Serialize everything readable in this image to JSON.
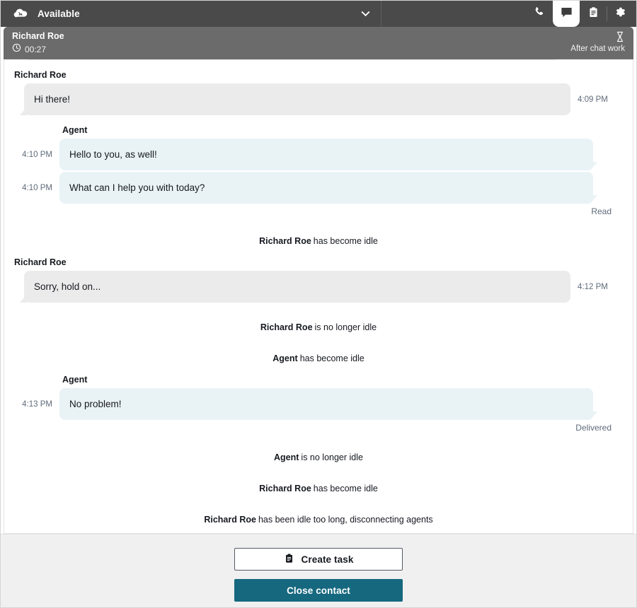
{
  "topbar": {
    "logo_icon": "connect-cloud-logo-icon",
    "agent_status": "Available",
    "status_dropdown_icon": "chevron-down-icon",
    "tabs": [
      {
        "name": "phone-tab",
        "icon": "phone-icon",
        "active": false
      },
      {
        "name": "chat-tab",
        "icon": "chat-icon",
        "active": true
      },
      {
        "name": "tasks-tab",
        "icon": "clipboard-icon",
        "active": false
      },
      {
        "name": "settings-tab",
        "icon": "gear-icon",
        "active": false
      }
    ]
  },
  "contact_header": {
    "contact_name": "Richard Roe",
    "timer_icon": "clock-icon",
    "timer": "00:27",
    "state_icon": "hourglass-icon",
    "state_label": "After chat work"
  },
  "transcript": {
    "messages": [
      {
        "kind": "message",
        "side": "customer",
        "sender": "Richard Roe",
        "text": "Hi there!",
        "time": "4:09 PM",
        "receipt": ""
      },
      {
        "kind": "message",
        "side": "agent",
        "sender": "Agent",
        "text": "Hello to you, as well!",
        "time": "4:10 PM",
        "receipt": ""
      },
      {
        "kind": "message",
        "side": "agent",
        "sender": "",
        "text": "What can I help you with today?",
        "time": "4:10 PM",
        "receipt": "Read"
      },
      {
        "kind": "system",
        "who": "Richard Roe",
        "what": "has become idle"
      },
      {
        "kind": "message",
        "side": "customer",
        "sender": "Richard Roe",
        "text": "Sorry, hold on...",
        "time": "4:12 PM",
        "receipt": ""
      },
      {
        "kind": "system",
        "who": "Richard Roe",
        "what": "is no longer idle"
      },
      {
        "kind": "system",
        "who": "Agent",
        "what": "has become idle"
      },
      {
        "kind": "message",
        "side": "agent",
        "sender": "Agent",
        "text": "No problem!",
        "time": "4:13 PM",
        "receipt": "Delivered"
      },
      {
        "kind": "system",
        "who": "Agent",
        "what": "is no longer idle"
      },
      {
        "kind": "system",
        "who": "Richard Roe",
        "what": "has become idle"
      },
      {
        "kind": "system",
        "who": "Richard Roe",
        "what": "has been idle too long, disconnecting agents"
      }
    ]
  },
  "footer": {
    "create_task_icon": "clipboard-icon",
    "create_task_label": "Create task",
    "close_contact_label": "Close contact"
  },
  "colors": {
    "topbar_bg": "#4a4a4a",
    "contact_header_bg": "#6b6b6b",
    "customer_bubble": "#ebebeb",
    "agent_bubble": "#e9f3f6",
    "primary_button": "#16687f",
    "footer_bg": "#f0f0f0"
  }
}
